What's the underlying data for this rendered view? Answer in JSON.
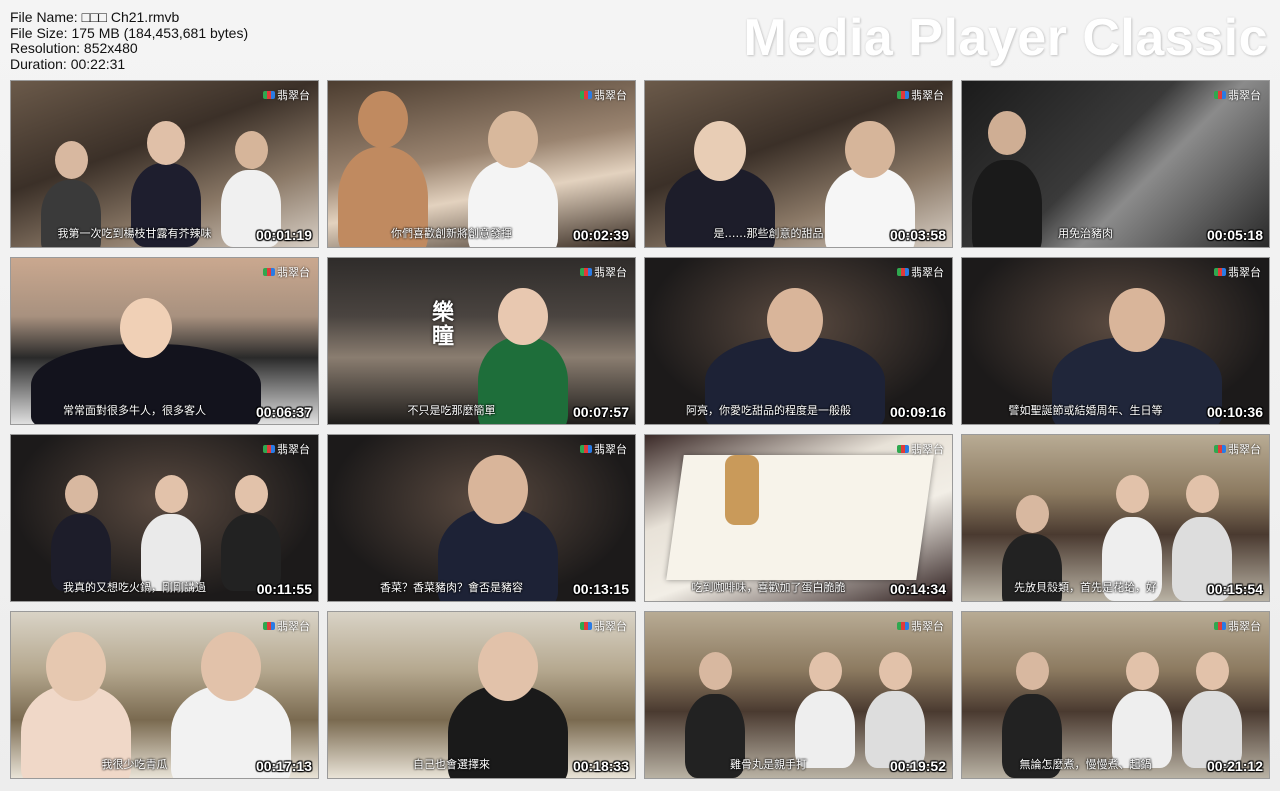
{
  "header": {
    "file_name": "File Name: □□□ Ch21.rmvb",
    "file_size": "File Size: 175 MB (184,453,681 bytes)",
    "resolution": "Resolution: 852x480",
    "duration": "Duration: 00:22:31"
  },
  "watermark": "Media Player Classic",
  "logo_text": "翡翠台",
  "thumbnails": [
    {
      "scene": "s-restaurant",
      "subtitle": "我第一次吃到楊枝甘露有芥辣味",
      "time": "00:01:19",
      "logo": true
    },
    {
      "scene": "s-restaurant2",
      "subtitle": "你們喜歡創新將創意發揮",
      "time": "00:02:39",
      "logo": true
    },
    {
      "scene": "s-restaurant",
      "subtitle": "是……那些創意的甜品",
      "time": "00:03:58",
      "logo": true
    },
    {
      "scene": "s-kitchen",
      "subtitle": "用免治豬肉",
      "time": "00:05:18",
      "logo": true
    },
    {
      "scene": "s-closeup",
      "subtitle": "常常面對很多牛人，很多客人",
      "time": "00:06:37",
      "logo": true
    },
    {
      "scene": "s-street",
      "subtitle": "不只是吃那麼簡單",
      "time": "00:07:57",
      "logo": true,
      "overlay": "樂瞳"
    },
    {
      "scene": "s-dark",
      "subtitle": "阿亮，你愛吃甜品的程度是一般般",
      "time": "00:09:16",
      "logo": true
    },
    {
      "scene": "s-dark",
      "subtitle": "譬如聖誕節或結婚周年、生日等",
      "time": "00:10:36",
      "logo": true
    },
    {
      "scene": "s-dark",
      "subtitle": "我真的又想吃火鍋，剛剛講過",
      "time": "00:11:55",
      "logo": true
    },
    {
      "scene": "s-dark",
      "subtitle": "香菜？香菜豬肉？會否是豬容",
      "time": "00:13:15",
      "logo": true
    },
    {
      "scene": "s-dessert",
      "subtitle": "吃到咖啡味，喜歡加了蛋白脆脆",
      "time": "00:14:34",
      "logo": true
    },
    {
      "scene": "s-hotpot",
      "subtitle": "先放貝殼類，首先是花蛤，好",
      "time": "00:15:54",
      "logo": true
    },
    {
      "scene": "s-booth",
      "subtitle": "我很少吃青瓜",
      "time": "00:17:13",
      "logo": true
    },
    {
      "scene": "s-booth",
      "subtitle": "自己也會選擇來",
      "time": "00:18:33",
      "logo": true
    },
    {
      "scene": "s-hotpot",
      "subtitle": "雞骨丸是親手打",
      "time": "00:19:52",
      "logo": true
    },
    {
      "scene": "s-hotpot",
      "subtitle": "無論怎麼煮，慢慢煮、起鍋",
      "time": "00:21:12",
      "logo": true
    }
  ]
}
